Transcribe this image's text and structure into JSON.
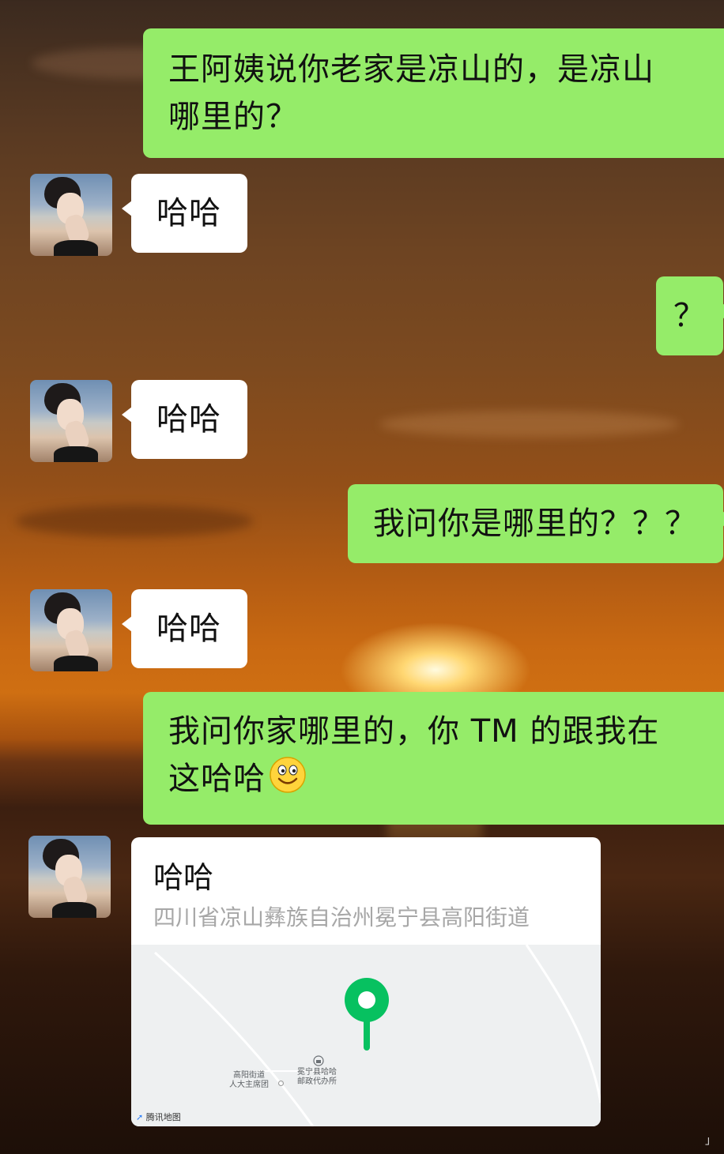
{
  "messages": [
    {
      "from": "me",
      "text_lines": [
        "王阿姨说你老家是凉山的，是凉山",
        "哪里的？"
      ]
    },
    {
      "from": "her",
      "text": "哈哈"
    },
    {
      "from": "me",
      "text": "？"
    },
    {
      "from": "her",
      "text": "哈哈"
    },
    {
      "from": "me",
      "text": "我问你是哪里的？？？"
    },
    {
      "from": "her",
      "text": "哈哈"
    },
    {
      "from": "me",
      "text_lines": [
        "我问你家哪里的，你 TM 的跟我在",
        "这哈哈"
      ],
      "emoji": "smiley-emoji"
    },
    {
      "from": "her",
      "type": "location",
      "title": "哈哈",
      "address": "四川省凉山彝族自治州冕宁县高阳街道",
      "map": {
        "labels": [
          "高阳街道",
          "人大主席团",
          "冕宁县哈哈",
          "邮政代办所"
        ],
        "credit": "腾讯地图",
        "pin_color": "#07c160"
      }
    }
  ],
  "colors": {
    "my_bubble": "#95ec69",
    "her_bubble": "#ffffff",
    "pin": "#07c160"
  },
  "corner_mark": "」"
}
